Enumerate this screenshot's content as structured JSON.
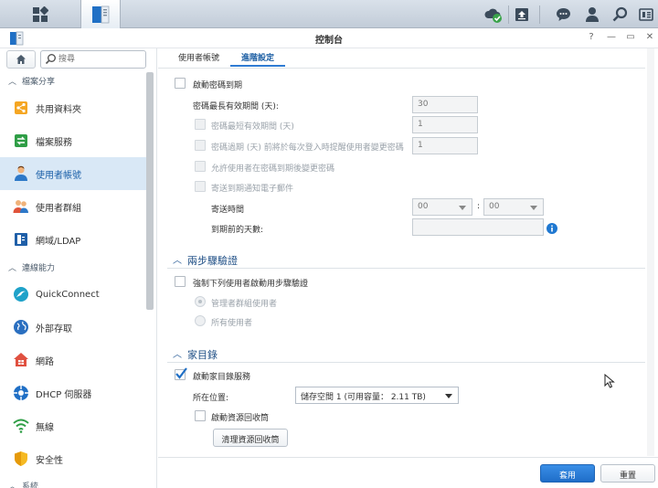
{
  "taskbar": {
    "icons": [
      "main-menu-icon",
      "control-panel-icon",
      "cloud-sync-icon",
      "upload-icon",
      "chat-icon",
      "user-icon",
      "search-icon",
      "widgets-icon"
    ]
  },
  "window": {
    "title": "控制台",
    "controls": [
      "?",
      "—",
      "▭",
      "✕"
    ]
  },
  "sidebar": {
    "search_placeholder": "搜尋",
    "categories": [
      {
        "label": "檔案分享"
      },
      {
        "label": "連線能力"
      },
      {
        "label": "系統"
      }
    ],
    "items": [
      {
        "label": "共用資料夾",
        "icon": "shared-folder-icon"
      },
      {
        "label": "檔案服務",
        "icon": "file-services-icon"
      },
      {
        "label": "使用者帳號",
        "icon": "user-account-icon",
        "active": true
      },
      {
        "label": "使用者群組",
        "icon": "user-group-icon"
      },
      {
        "label": "網域/LDAP",
        "icon": "ldap-icon"
      },
      {
        "label": "QuickConnect",
        "icon": "quickconnect-icon"
      },
      {
        "label": "外部存取",
        "icon": "external-access-icon"
      },
      {
        "label": "網路",
        "icon": "network-icon"
      },
      {
        "label": "DHCP 伺服器",
        "icon": "dhcp-icon"
      },
      {
        "label": "無線",
        "icon": "wireless-icon"
      },
      {
        "label": "安全性",
        "icon": "security-icon"
      }
    ]
  },
  "tabs": [
    {
      "label": "使用者帳號"
    },
    {
      "label": "進階設定",
      "active": true
    }
  ],
  "password_expiry": {
    "enable_label": "啟動密碼到期",
    "max_age_label": "密碼最長有效期間 (天):",
    "max_age_value": "30",
    "min_age_label": "密碼最短有效期間 (天)",
    "min_age_value": "1",
    "remind_label": "密碼過期 (天) 前將於每次登入時提醒使用者變更密碼",
    "remind_value": "1",
    "allow_change_label": "允許使用者在密碼到期後變更密碼",
    "send_email_label": "寄送到期通知電子郵件",
    "send_time_label": "寄送時間",
    "hour_value": "00",
    "time_sep": ":",
    "minute_value": "00",
    "days_before_label": "到期前的天數:"
  },
  "two_step": {
    "title": "兩步驟驗證",
    "enforce_label": "強制下列使用者啟動用步驟驗證",
    "option_admin": "管理者群組使用者",
    "option_all": "所有使用者"
  },
  "home": {
    "title": "家目錄",
    "enable_label": "啟動家目錄服務",
    "enable_checked": true,
    "location_label": "所在位置:",
    "location_value": "儲存空間 1 (可用容量： 2.11 TB)",
    "recycle_label": "啟動資源回收筒",
    "empty_recycle_label": "清理資源回收筒"
  },
  "footer": {
    "apply_label": "套用",
    "reset_label": "重置"
  }
}
